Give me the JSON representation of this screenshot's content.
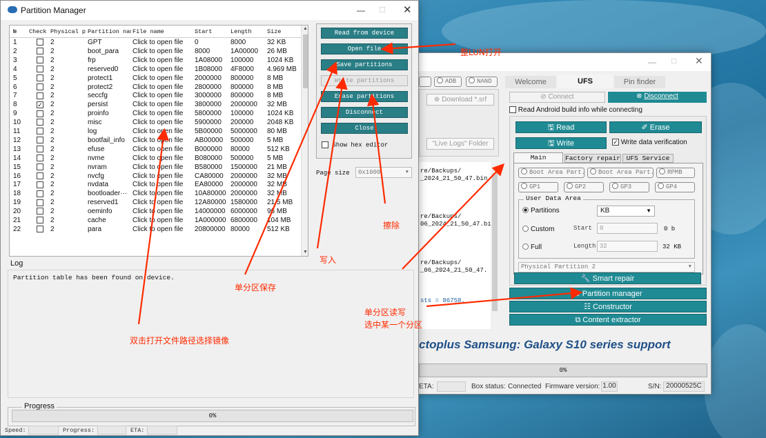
{
  "pm": {
    "title": "Partition Manager",
    "columns": [
      "№",
      "Check",
      "Physical p",
      "Partition nam",
      "File name",
      "Start",
      "Length",
      "Size"
    ],
    "rows": [
      {
        "n": "1",
        "chk": false,
        "phys": "2",
        "name": "GPT",
        "file": "Click to open file",
        "start": "0",
        "len": "8000",
        "size": "32 KB"
      },
      {
        "n": "2",
        "chk": false,
        "phys": "2",
        "name": "boot_para",
        "file": "Click to open file",
        "start": "8000",
        "len": "1A00000",
        "size": "26 MB"
      },
      {
        "n": "3",
        "chk": false,
        "phys": "2",
        "name": "frp",
        "file": "Click to open file",
        "start": "1A08000",
        "len": "100000",
        "size": "1024 KB"
      },
      {
        "n": "4",
        "chk": false,
        "phys": "2",
        "name": "reserved0",
        "file": "Click to open file",
        "start": "1B08000",
        "len": "4F8000",
        "size": "4.969 MB"
      },
      {
        "n": "5",
        "chk": false,
        "phys": "2",
        "name": "protect1",
        "file": "Click to open file",
        "start": "2000000",
        "len": "800000",
        "size": "8 MB"
      },
      {
        "n": "6",
        "chk": false,
        "phys": "2",
        "name": "protect2",
        "file": "Click to open file",
        "start": "2800000",
        "len": "800000",
        "size": "8 MB"
      },
      {
        "n": "7",
        "chk": false,
        "phys": "2",
        "name": "seccfg",
        "file": "Click to open file",
        "start": "3000000",
        "len": "800000",
        "size": "8 MB"
      },
      {
        "n": "8",
        "chk": true,
        "phys": "2",
        "name": "persist",
        "file": "Click to open file",
        "start": "3800000",
        "len": "2000000",
        "size": "32 MB"
      },
      {
        "n": "9",
        "chk": false,
        "phys": "2",
        "name": "proinfo",
        "file": "Click to open file",
        "start": "5800000",
        "len": "100000",
        "size": "1024 KB"
      },
      {
        "n": "10",
        "chk": false,
        "phys": "2",
        "name": "misc",
        "file": "Click to open file",
        "start": "5900000",
        "len": "200000",
        "size": "2048 KB"
      },
      {
        "n": "11",
        "chk": false,
        "phys": "2",
        "name": "log",
        "file": "Click to open file",
        "start": "5B00000",
        "len": "5000000",
        "size": "80 MB"
      },
      {
        "n": "12",
        "chk": false,
        "phys": "2",
        "name": "bootfail_info",
        "file": "Click to open file",
        "start": "AB00000",
        "len": "500000",
        "size": "5 MB"
      },
      {
        "n": "13",
        "chk": false,
        "phys": "2",
        "name": "efuse",
        "file": "Click to open file",
        "start": "B000000",
        "len": "80000",
        "size": "512 KB"
      },
      {
        "n": "14",
        "chk": false,
        "phys": "2",
        "name": "nvme",
        "file": "Click to open file",
        "start": "B080000",
        "len": "500000",
        "size": "5 MB"
      },
      {
        "n": "15",
        "chk": false,
        "phys": "2",
        "name": "nvram",
        "file": "Click to open file",
        "start": "B580000",
        "len": "1500000",
        "size": "21 MB"
      },
      {
        "n": "16",
        "chk": false,
        "phys": "2",
        "name": "nvcfg",
        "file": "Click to open file",
        "start": "CA80000",
        "len": "2000000",
        "size": "32 MB"
      },
      {
        "n": "17",
        "chk": false,
        "phys": "2",
        "name": "nvdata",
        "file": "Click to open file",
        "start": "EA80000",
        "len": "2000000",
        "size": "32 MB"
      },
      {
        "n": "18",
        "chk": false,
        "phys": "2",
        "name": "bootloader···",
        "file": "Click to open file",
        "start": "10A80000",
        "len": "2000000",
        "size": "32 MB"
      },
      {
        "n": "19",
        "chk": false,
        "phys": "2",
        "name": "reserved1",
        "file": "Click to open file",
        "start": "12A80000",
        "len": "1580000",
        "size": "21.5 MB"
      },
      {
        "n": "20",
        "chk": false,
        "phys": "2",
        "name": "oeminfo",
        "file": "Click to open file",
        "start": "14000000",
        "len": "6000000",
        "size": "96 MB"
      },
      {
        "n": "21",
        "chk": false,
        "phys": "2",
        "name": "cache",
        "file": "Click to open file",
        "start": "1A000000",
        "len": "6800000",
        "size": "104 MB"
      },
      {
        "n": "22",
        "chk": false,
        "phys": "2",
        "name": "para",
        "file": "Click to open file",
        "start": "20800000",
        "len": "80000",
        "size": "512 KB"
      }
    ],
    "buttons": {
      "read": "Read from device",
      "open": "Open file",
      "save": "Save partitions",
      "write": "Write partitions",
      "erase": "Erase partitions",
      "disconnect": "Disconnect",
      "close": "Close"
    },
    "show_hex": "Show hex editor",
    "page_size_label": "Page size",
    "page_size_value": "0x1000",
    "log_label": "Log",
    "log_text": "Partition table has been found on device.",
    "progress_label": "Progress",
    "progress_pct": "0%",
    "progress_value": 0,
    "status": {
      "speed": "Speed:",
      "progress": "Progress:",
      "eta": "ETA:"
    }
  },
  "octo": {
    "tabs": [
      "Welcome",
      "UFS",
      "Pin finder"
    ],
    "mode_radios": [
      "ADB",
      "NAND"
    ],
    "download": "Download *.srf",
    "live_logs": "\"Live Logs\" Folder",
    "connect": "Connect",
    "disconnect": "Disconnect",
    "read_info": "Read Android build info while connecting",
    "read": "Read",
    "erase": "Erase",
    "write": "Write",
    "verify": "Write data verification",
    "subtabs": [
      "Main",
      "Factory repair",
      "UFS Service"
    ],
    "part_radios": [
      "Boot Area Part.",
      "Boot Area Part.",
      "RPMB",
      "GP1",
      "GP2",
      "GP3",
      "GP4"
    ],
    "uda_label": "User Data Area",
    "partitions_label": "Partitions",
    "unit": "KB",
    "custom_label": "Custom",
    "start_label": "Start",
    "start_val": "0",
    "start_unit": "0 b",
    "full_label": "Full",
    "length_label": "Length",
    "length_val": "32",
    "length_unit": "32 KB",
    "physical": "Physical Partition 2",
    "smart_repair": "Smart repair",
    "partition_manager": "Partition manager",
    "constructor": "Constructor",
    "content_extractor": "Content extractor",
    "log_lines": [
      "re/Backups/",
      "_2024_21_50_47.bin",
      "re/Backups/",
      "06_2024_21_50_47.bi",
      "re/Backups/",
      "_06_2024_21_50_47.",
      "sts = 86758."
    ],
    "banner": "ctoplus Samsung: Galaxy S10 series support",
    "progress_pct": "0%",
    "eta": "ETA:",
    "box_status_label": "Box status:",
    "box_status": "Connected",
    "fw_label": "Firmware version:",
    "fw": "1.00",
    "sn_label": "S/N:",
    "sn": "20000525C"
  },
  "annotations": {
    "open_lun": "整LUN打开",
    "erase": "擦除",
    "write": "写入",
    "save_single": "单分区保存",
    "rw_single_1": "单分区读写",
    "rw_single_2": "选中某一个分区",
    "dbl_click": "双击打开文件路径选择镜像"
  },
  "colors": {
    "accent": "#1f8a93",
    "annotation": "#ff2a00"
  }
}
